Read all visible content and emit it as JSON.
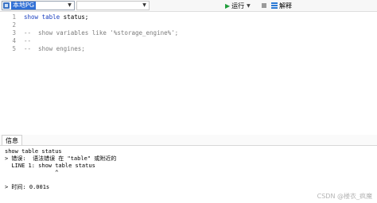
{
  "toolbar": {
    "connection": "本地PG",
    "database": "",
    "run_label": "运行",
    "explain_label": "解释",
    "icons": [
      "database-icon",
      "play-icon",
      "stop-icon",
      "explain-icon"
    ]
  },
  "editor": {
    "line_numbers": [
      "1",
      "2",
      "3",
      "4",
      "5"
    ],
    "lines": [
      {
        "keyword": "show table",
        "rest": " status;"
      },
      {
        "text": ""
      },
      {
        "text": "--  show variables like '%storage_engine%';"
      },
      {
        "text": "--"
      },
      {
        "text": "--  show engines;"
      }
    ]
  },
  "info": {
    "tab_label": "信息",
    "output": [
      "show table status",
      "> 错误:  语法错误 在 \"table\" 或附近的",
      "  LINE 1: show table status",
      "               ^",
      "",
      "> 时间: 0.001s"
    ]
  },
  "watermark": "CSDN @楼衣_疯魔",
  "colors": {
    "keyword": "#1a3fbf",
    "comment": "#7b7b7b",
    "run_icon": "#1f9d3a",
    "selection": "#2f6fd6"
  }
}
